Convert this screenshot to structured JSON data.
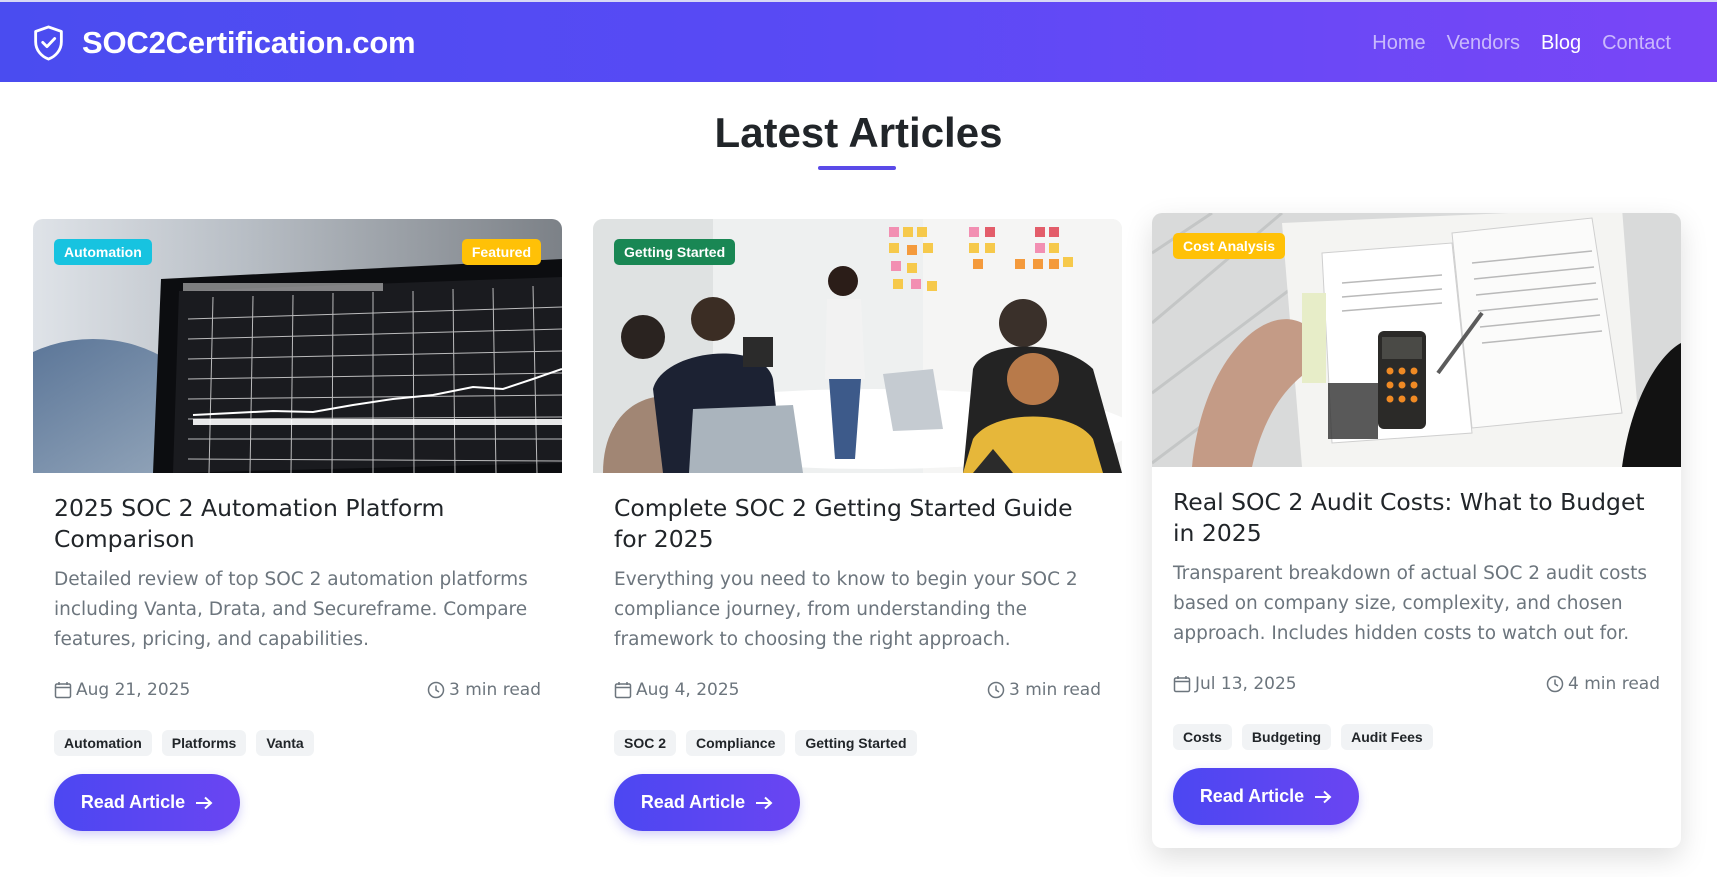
{
  "site": {
    "brand": "SOC2Certification.com"
  },
  "nav": [
    {
      "label": "Home",
      "active": false
    },
    {
      "label": "Vendors",
      "active": false
    },
    {
      "label": "Blog",
      "active": true
    },
    {
      "label": "Contact",
      "active": false
    }
  ],
  "section": {
    "title": "Latest Articles"
  },
  "articles": [
    {
      "category": "Automation",
      "category_color": "#17c3e0",
      "featured": "Featured",
      "featured_color": "#ffc107",
      "title": "2025 SOC 2 Automation Platform Comparison",
      "description": "Detailed review of top SOC 2 automation platforms including Vanta, Drata, and Secureframe. Compare features, pricing, and capabilities.",
      "date": "Aug 21, 2025",
      "read_time": "3 min read",
      "tags": [
        "Automation",
        "Platforms",
        "Vanta"
      ],
      "button": "Read Article",
      "image": "trading-chart-laptop-photo"
    },
    {
      "category": "Getting Started",
      "category_color": "#198754",
      "title": "Complete SOC 2 Getting Started Guide for 2025",
      "description": "Everything you need to know to begin your SOC 2 compliance journey, from understanding the framework to choosing the right approach.",
      "date": "Aug 4, 2025",
      "read_time": "3 min read",
      "tags": [
        "SOC 2",
        "Compliance",
        "Getting Started"
      ],
      "button": "Read Article",
      "image": "team-meeting-sticky-notes-photo"
    },
    {
      "category": "Cost Analysis",
      "category_color": "#ffc107",
      "title": "Real SOC 2 Audit Costs: What to Budget in 2025",
      "description": "Transparent breakdown of actual SOC 2 audit costs based on company size, complexity, and chosen approach. Includes hidden costs to watch out for.",
      "date": "Jul 13, 2025",
      "read_time": "4 min read",
      "tags": [
        "Costs",
        "Budgeting",
        "Audit Fees"
      ],
      "button": "Read Article",
      "image": "tax-forms-calculator-photo"
    }
  ],
  "icons": {
    "brand": "shield-check-icon",
    "date": "calendar-icon",
    "read": "clock-icon",
    "button": "arrow-right-icon"
  }
}
